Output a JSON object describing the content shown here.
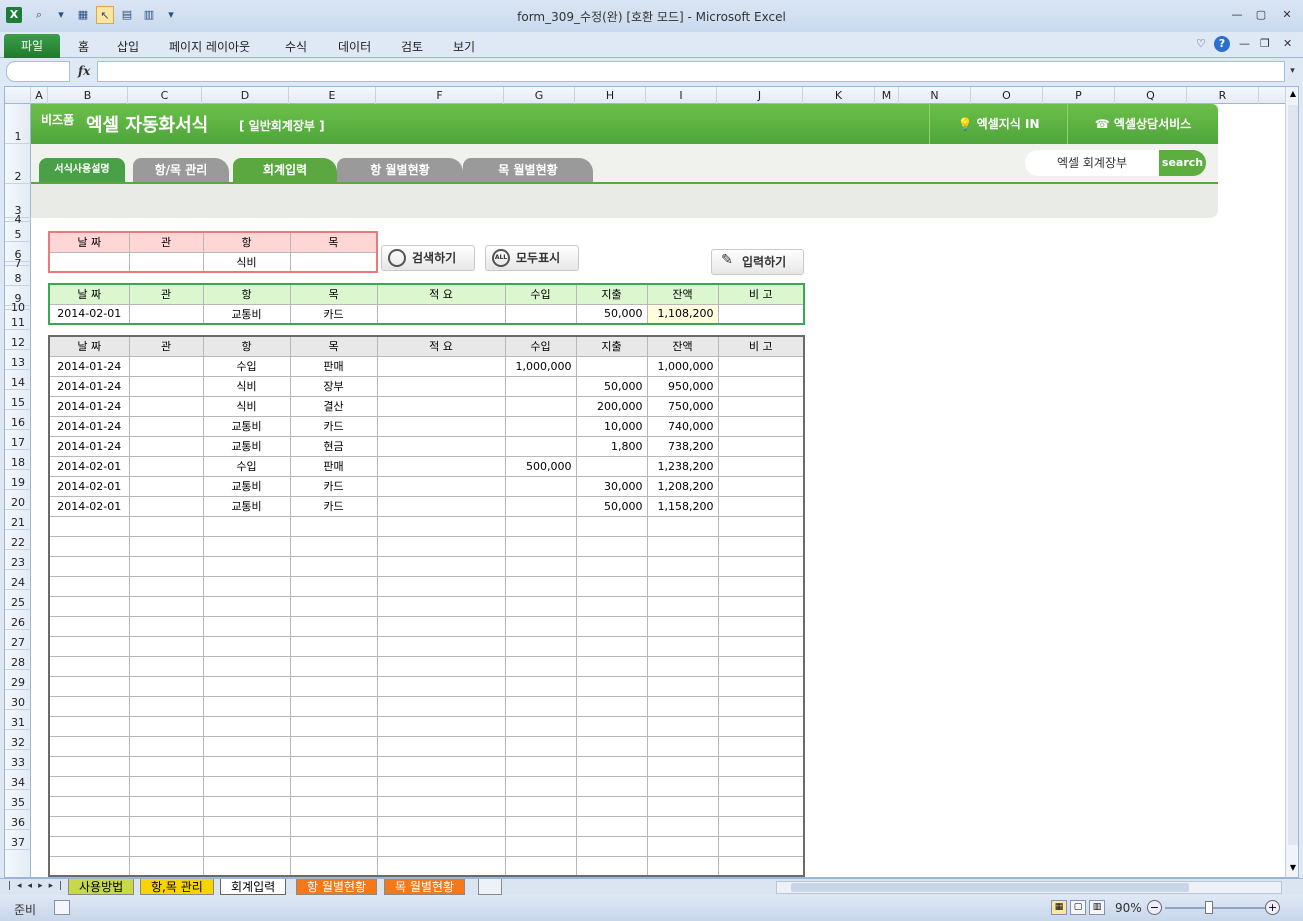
{
  "window": {
    "title": "form_309_수정(완)  [호환 모드]  -  Microsoft Excel"
  },
  "ribbon": {
    "file_tab": "파일",
    "tabs": [
      "홈",
      "삽입",
      "페이지 레이아웃",
      "수식",
      "데이터",
      "검토",
      "보기"
    ]
  },
  "formula_bar": {
    "fx": "fx",
    "value": ""
  },
  "columns": [
    "A",
    "B",
    "C",
    "D",
    "E",
    "F",
    "G",
    "H",
    "I",
    "J",
    "K",
    "M",
    "N",
    "O",
    "P",
    "Q",
    "R"
  ],
  "rows": [
    "1",
    "2",
    "3",
    "4",
    "5",
    "6",
    "7",
    "8",
    "9",
    "10",
    "11",
    "12",
    "13",
    "14",
    "15",
    "16",
    "17",
    "18",
    "19",
    "20",
    "21",
    "22",
    "23",
    "24",
    "25",
    "26",
    "27",
    "28",
    "29",
    "30",
    "31",
    "32",
    "33",
    "34",
    "35",
    "36",
    "37"
  ],
  "banner": {
    "brand": "비즈폼",
    "title": "엑셀 자동화서식",
    "subtitle": "[ 일반회계장부 ]",
    "link1": "엑셀지식 IN",
    "link2": "엑셀상담서비스"
  },
  "tabs": {
    "guide": "서식사용설명",
    "items": [
      "항/목 관리",
      "회계입력",
      "항 월별현황",
      "목 월별현황"
    ],
    "search_value": "엑셀 회계장부",
    "search_btn": "search"
  },
  "search_table": {
    "headers": [
      "날  짜",
      "관",
      "항",
      "목"
    ],
    "values": [
      "",
      "",
      "식비",
      ""
    ]
  },
  "buttons": {
    "search": "검색하기",
    "show_all": "모두표시",
    "all_icon": "ALL",
    "input": "입력하기"
  },
  "input_table": {
    "headers": [
      "날  짜",
      "관",
      "항",
      "목",
      "적    요",
      "수입",
      "지출",
      "잔액",
      "비  고"
    ],
    "values": [
      "2014-02-01",
      "",
      "교통비",
      "카드",
      "",
      "",
      "50,000",
      "1,108,200",
      ""
    ]
  },
  "list_table": {
    "headers": [
      "날  짜",
      "관",
      "항",
      "목",
      "적    요",
      "수입",
      "지출",
      "잔액",
      "비  고"
    ],
    "rows": [
      [
        "2014-01-24",
        "",
        "수입",
        "판매",
        "",
        "1,000,000",
        "",
        "1,000,000",
        ""
      ],
      [
        "2014-01-24",
        "",
        "식비",
        "장부",
        "",
        "",
        "50,000",
        "950,000",
        ""
      ],
      [
        "2014-01-24",
        "",
        "식비",
        "결산",
        "",
        "",
        "200,000",
        "750,000",
        ""
      ],
      [
        "2014-01-24",
        "",
        "교통비",
        "카드",
        "",
        "",
        "10,000",
        "740,000",
        ""
      ],
      [
        "2014-01-24",
        "",
        "교통비",
        "현금",
        "",
        "",
        "1,800",
        "738,200",
        ""
      ],
      [
        "2014-02-01",
        "",
        "수입",
        "판매",
        "",
        "500,000",
        "",
        "1,238,200",
        ""
      ],
      [
        "2014-02-01",
        "",
        "교통비",
        "카드",
        "",
        "",
        "30,000",
        "1,208,200",
        ""
      ],
      [
        "2014-02-01",
        "",
        "교통비",
        "카드",
        "",
        "",
        "50,000",
        "1,158,200",
        ""
      ]
    ]
  },
  "sheet_tabs": [
    "사용방법",
    "항,목 관리",
    "회계입력",
    "항 월별현황",
    "목 월별현황"
  ],
  "status": {
    "ready": "준비",
    "zoom": "90%"
  },
  "colors": {
    "brand_green": "#5aa83f",
    "active_tab": "#ffffff",
    "search_border": "#e87a7a",
    "input_border": "#39a852"
  }
}
